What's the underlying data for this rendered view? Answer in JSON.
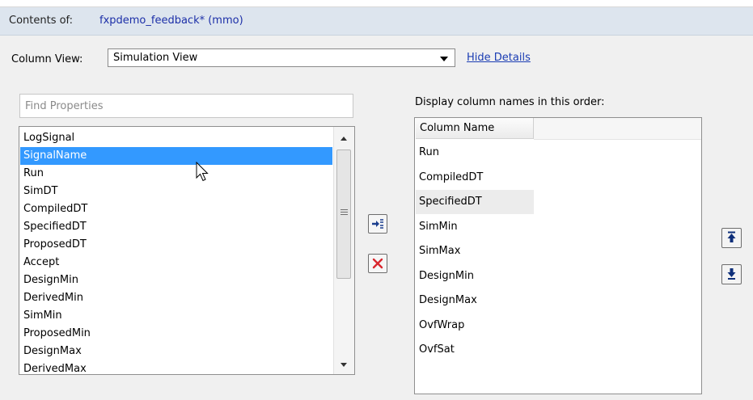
{
  "header": {
    "contents_label": "Contents of:",
    "model_name": "fxpdemo_feedback* (mmo)"
  },
  "column_view": {
    "label": "Column View:",
    "selected": "Simulation View",
    "hide_details_link": "Hide Details"
  },
  "find": {
    "placeholder": "Find Properties",
    "value": ""
  },
  "properties": [
    "LogSignal",
    "SignalName",
    "Run",
    "SimDT",
    "CompiledDT",
    "SpecifiedDT",
    "ProposedDT",
    "Accept",
    "DesignMin",
    "DerivedMin",
    "SimMin",
    "ProposedMin",
    "DesignMax",
    "DerivedMax"
  ],
  "selected_property": "SignalName",
  "display": {
    "caption": "Display column names in this order:",
    "column_header": "Column Name",
    "columns": [
      "Run",
      "CompiledDT",
      "SpecifiedDT",
      "SimMin",
      "SimMax",
      "DesignMin",
      "DesignMax",
      "OvfWrap",
      "OvfSat"
    ],
    "highlighted": "SpecifiedDT"
  },
  "icons": {
    "add": "add-column-icon",
    "remove": "remove-column-icon",
    "up": "move-up-icon",
    "down": "move-down-icon"
  },
  "colors": {
    "selection": "#3399ff",
    "link": "#1a3cb3",
    "header_bg": "#dde5ee",
    "remove_red": "#d9272e"
  }
}
